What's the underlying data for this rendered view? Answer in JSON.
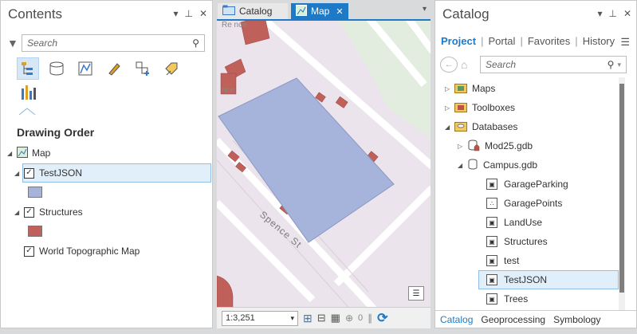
{
  "contents": {
    "title": "Contents",
    "search_placeholder": "Search",
    "section": "Drawing Order",
    "layers": [
      {
        "label": "Map"
      },
      {
        "label": "TestJSON",
        "swatch": "#a6b4dc"
      },
      {
        "label": "Structures",
        "swatch": "#c0605a"
      },
      {
        "label": "World Topographic Map"
      }
    ]
  },
  "tabs": {
    "catalog": "Catalog",
    "map": "Map"
  },
  "map": {
    "scale": "1:3,251",
    "street_label": "Spence St",
    "label_fragment_1": "Re   nce",
    "label_fragment_2": "nce",
    "selection_count": "0"
  },
  "catalog": {
    "title": "Catalog",
    "tabs": [
      "Project",
      "Portal",
      "Favorites",
      "History"
    ],
    "search_placeholder": "Search",
    "tree": [
      {
        "label": "Maps"
      },
      {
        "label": "Toolboxes"
      },
      {
        "label": "Databases"
      },
      {
        "label": "Mod25.gdb"
      },
      {
        "label": "Campus.gdb"
      },
      {
        "label": "GarageParking"
      },
      {
        "label": "GaragePoints"
      },
      {
        "label": "LandUse"
      },
      {
        "label": "Structures"
      },
      {
        "label": "test"
      },
      {
        "label": "TestJSON"
      },
      {
        "label": "Trees"
      }
    ],
    "bottom_tabs": [
      "Catalog",
      "Geoprocessing",
      "Symbology"
    ]
  },
  "colors": {
    "accent": "#1e7ac7",
    "testjson_fill": "#a6b4dc",
    "structures_fill": "#c0605a",
    "map_background": "#ece4ec"
  }
}
